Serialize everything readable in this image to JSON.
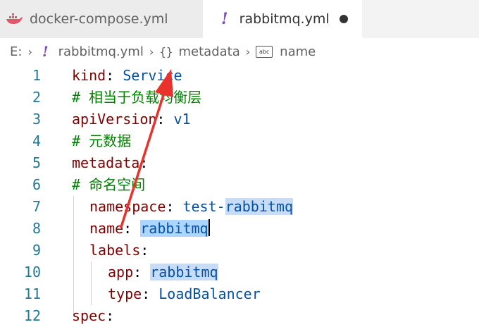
{
  "tabs": [
    {
      "label": "docker-compose.yml",
      "icon": "docker-icon",
      "active": false
    },
    {
      "label": "rabbitmq.yml",
      "icon": "yaml-bang-icon",
      "active": true,
      "dirty": true
    }
  ],
  "breadcrumb": {
    "root": "E:",
    "file": "rabbitmq.yml",
    "object": "metadata",
    "field": "name"
  },
  "editor": {
    "lines": [
      {
        "num": "1",
        "key": "kind",
        "value": "Service"
      },
      {
        "num": "2",
        "comment": "# 相当于负载均衡层"
      },
      {
        "num": "3",
        "key": "apiVersion",
        "value": "v1"
      },
      {
        "num": "4",
        "comment": "# 元数据"
      },
      {
        "num": "5",
        "key": "metadata"
      },
      {
        "num": "6",
        "comment": "# 命名空间"
      },
      {
        "num": "7",
        "key": "namespace",
        "value_prefix": "test-",
        "value": "rabbitmq"
      },
      {
        "num": "8",
        "key": "name",
        "value": "rabbitmq"
      },
      {
        "num": "9",
        "key": "labels"
      },
      {
        "num": "10",
        "key": "app",
        "value": "rabbitmq"
      },
      {
        "num": "11",
        "key": "type",
        "value": "LoadBalancer"
      },
      {
        "num": "12",
        "key": "spec"
      }
    ]
  },
  "colors": {
    "key": "#800000",
    "value": "#0451a5",
    "comment": "#008000",
    "line_number": "#237893",
    "highlight": "#c7dcf7",
    "annotation_arrow": "#e8322b"
  }
}
